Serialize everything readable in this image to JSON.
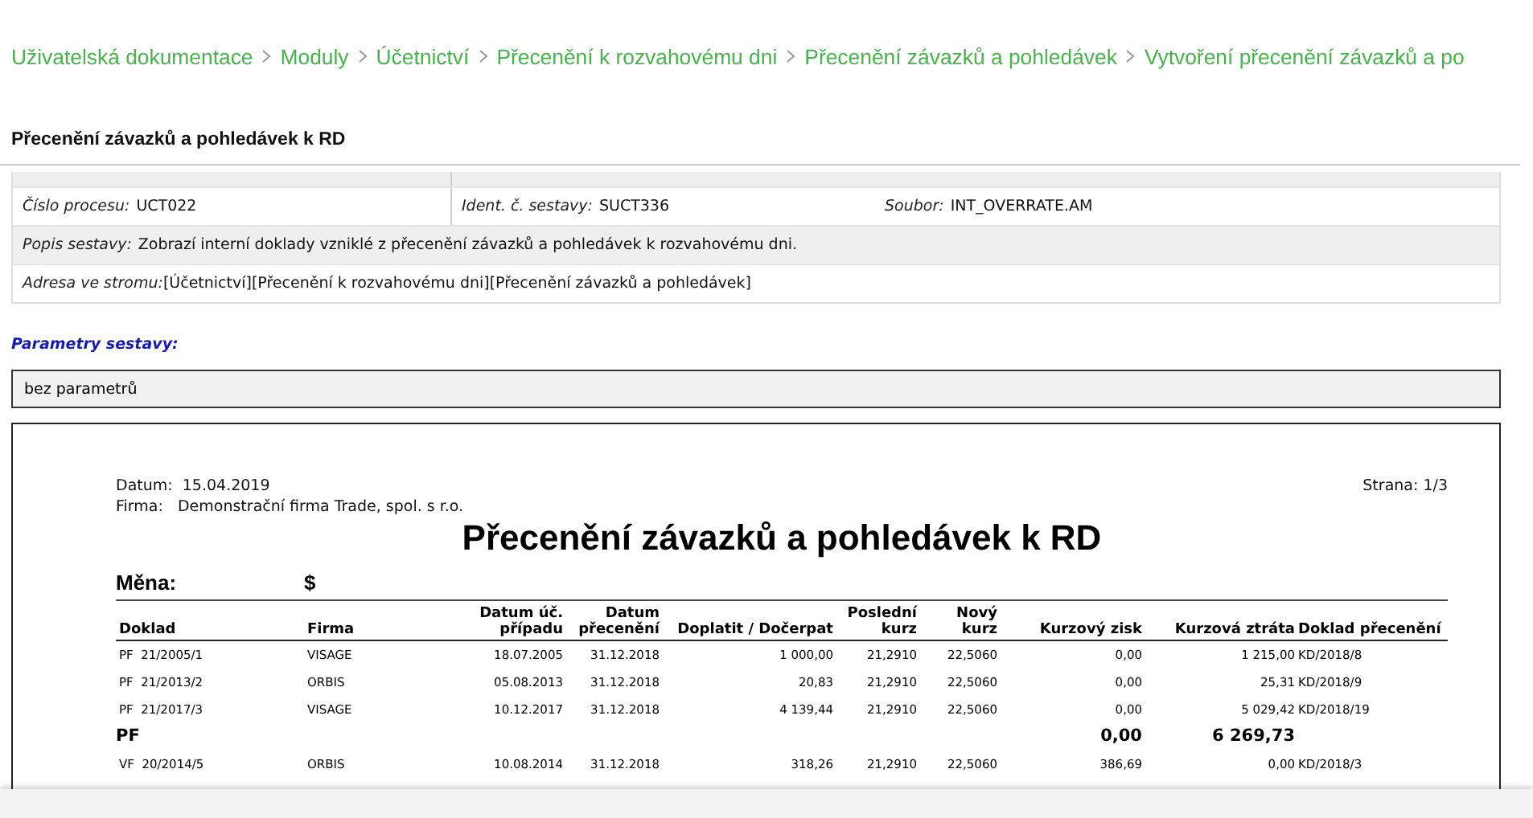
{
  "breadcrumb": [
    "Uživatelská dokumentace",
    "Moduly",
    "Účetnictví",
    "Přecenění k rozvahovému dni",
    "Přecenění závazků a pohledávek",
    "Vytvoření přecenění závazků a po"
  ],
  "section_title": "Přecenění závazků a pohledávek k RD",
  "info": {
    "process_label": "Číslo procesu:",
    "process_value": "UCT022",
    "ident_label": "Ident. č. sestavy:",
    "ident_value": "SUCT336",
    "file_label": "Soubor:",
    "file_value": "INT_OVERRATE.AM",
    "desc_label": "Popis sestavy:",
    "desc_value": "Zobrazí interní doklady vzniklé z přecenění závazků a pohledávek k rozvahovému dni.",
    "path_label": "Adresa ve stromu:",
    "path_value": "[Účetnictví][Přecenění k rozvahovému dni][Přecenění závazků a pohledávek]"
  },
  "params_title": "Parametry sestavy:",
  "params_value": "bez parametrů",
  "report": {
    "date": "Datum:  15.04.2019",
    "firm": "Firma:   Demonstrační firma Trade, spol. s r.o.",
    "page": "Strana: 1/3",
    "title": "Přecenění závazků a pohledávek k RD",
    "currency_label": "Měna:",
    "currency_value": "$",
    "columns": [
      [
        "Doklad"
      ],
      [
        "Firma"
      ],
      [
        "Datum úč.",
        "případu"
      ],
      [
        "Datum",
        "přecenění"
      ],
      [
        "Doplatit / Dočerpat"
      ],
      [
        "Poslední",
        "kurz"
      ],
      [
        "Nový",
        "kurz"
      ],
      [
        "Kurzový zisk"
      ],
      [
        "Kurzová ztráta"
      ],
      [
        "Doklad přecenění"
      ]
    ],
    "rows": [
      {
        "kind": "item",
        "cells": [
          "PF  21/2005/1",
          "VISAGE",
          "18.07.2005",
          "31.12.2018",
          "1 000,00",
          "21,2910",
          "22,5060",
          "0,00",
          "1 215,00",
          "KD/2018/8"
        ]
      },
      {
        "kind": "item",
        "cells": [
          "PF  21/2013/2",
          "ORBIS",
          "05.08.2013",
          "31.12.2018",
          "20,83",
          "21,2910",
          "22,5060",
          "0,00",
          "25,31",
          "KD/2018/9"
        ]
      },
      {
        "kind": "item",
        "cells": [
          "PF  21/2017/3",
          "VISAGE",
          "10.12.2017",
          "31.12.2018",
          "4 139,44",
          "21,2910",
          "22,5060",
          "0,00",
          "5 029,42",
          "KD/2018/19"
        ]
      },
      {
        "kind": "subtotal",
        "label": "PF",
        "gain": "0,00",
        "loss": "6 269,73"
      },
      {
        "kind": "item",
        "cells": [
          "VF  20/2014/5",
          "ORBIS",
          "10.08.2014",
          "31.12.2018",
          "318,26",
          "21,2910",
          "22,5060",
          "386,69",
          "0,00",
          "KD/2018/3"
        ]
      }
    ]
  }
}
